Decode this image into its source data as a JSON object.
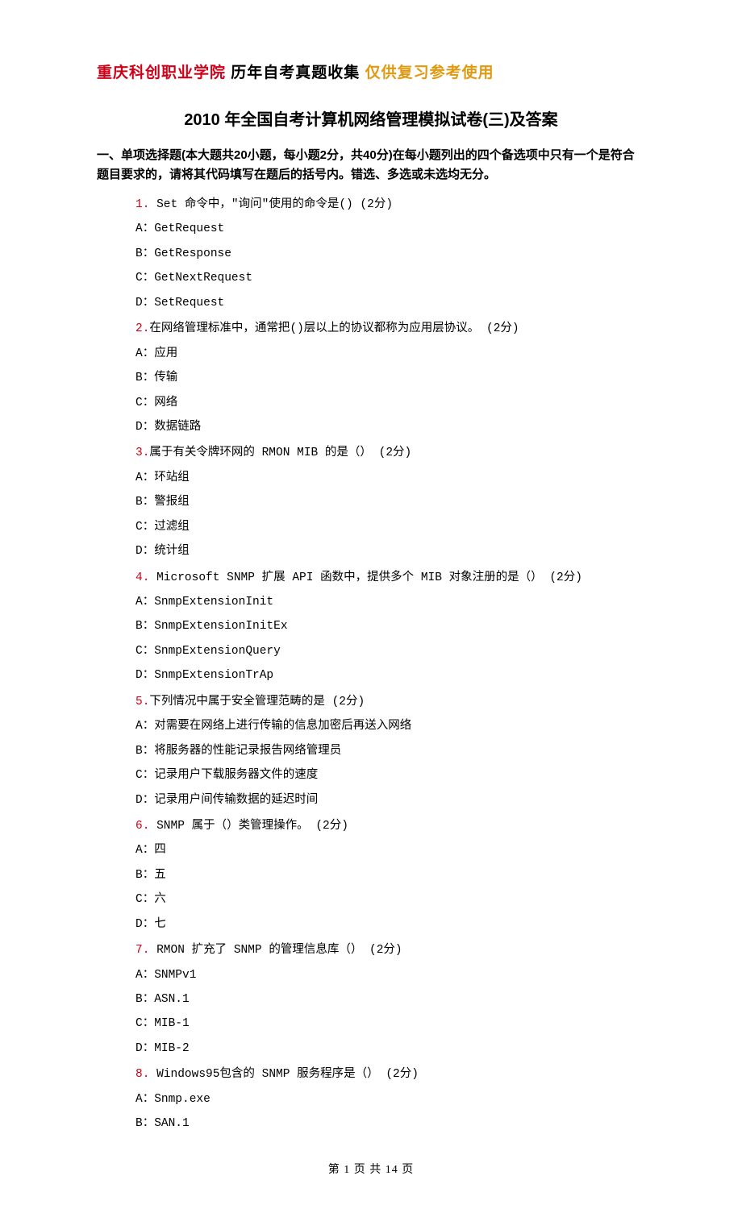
{
  "header": {
    "part1": "重庆科创职业学院",
    "part2": " 历年自考真题收集 ",
    "part3": "仅供复习参考使用"
  },
  "title": "2010 年全国自考计算机网络管理模拟试卷(三)及答案",
  "section_intro": "一、单项选择题(本大题共20小题，每小题2分，共40分)在每小题列出的四个备选项中只有一个是符合题目要求的，请将其代码填写在题后的括号内。错选、多选或未选均无分。",
  "questions": [
    {
      "num": "1.",
      "text": " Set 命令中，\"询问\"使用的命令是() (2分)",
      "options": [
        "A：GetRequest",
        "B：GetResponse",
        "C：GetNextRequest",
        "D：SetRequest"
      ]
    },
    {
      "num": "2.",
      "text": "在网络管理标准中，通常把()层以上的协议都称为应用层协议。 (2分)",
      "options": [
        "A：应用",
        "B：传输",
        "C：网络",
        "D：数据链路"
      ]
    },
    {
      "num": "3.",
      "text": "属于有关令牌环网的 RMON MIB 的是（） (2分)",
      "options": [
        "A：环站组",
        "B：警报组",
        "C：过滤组",
        "D：统计组"
      ]
    },
    {
      "num": "4.",
      "text": " Microsoft SNMP 扩展 API 函数中，提供多个 MIB 对象注册的是（） (2分)",
      "options": [
        "A：SnmpExtensionInit",
        "B：SnmpExtensionInitEx",
        "C：SnmpExtensionQuery",
        "D：SnmpExtensionTrAp"
      ]
    },
    {
      "num": "5.",
      "text": "下列情况中属于安全管理范畴的是 (2分)",
      "options": [
        "A：对需要在网络上进行传输的信息加密后再送入网络",
        "B：将服务器的性能记录报告网络管理员",
        "C：记录用户下载服务器文件的速度",
        "D：记录用户间传输数据的延迟时间"
      ]
    },
    {
      "num": "6.",
      "text": " SNMP 属于（）类管理操作。 (2分)",
      "options": [
        "A：四",
        "B：五",
        "C：六",
        "D：七"
      ]
    },
    {
      "num": "7.",
      "text": " RMON 扩充了 SNMP 的管理信息库（） (2分)",
      "options": [
        "A：SNMPv1",
        "B：ASN.1",
        "C：MIB-1",
        "D：MIB-2"
      ]
    },
    {
      "num": "8.",
      "text": " Windows95包含的 SNMP 服务程序是（） (2分)",
      "options": [
        "A：Snmp.exe",
        "B：SAN.1"
      ]
    }
  ],
  "footer": "第 1 页  共 14 页"
}
